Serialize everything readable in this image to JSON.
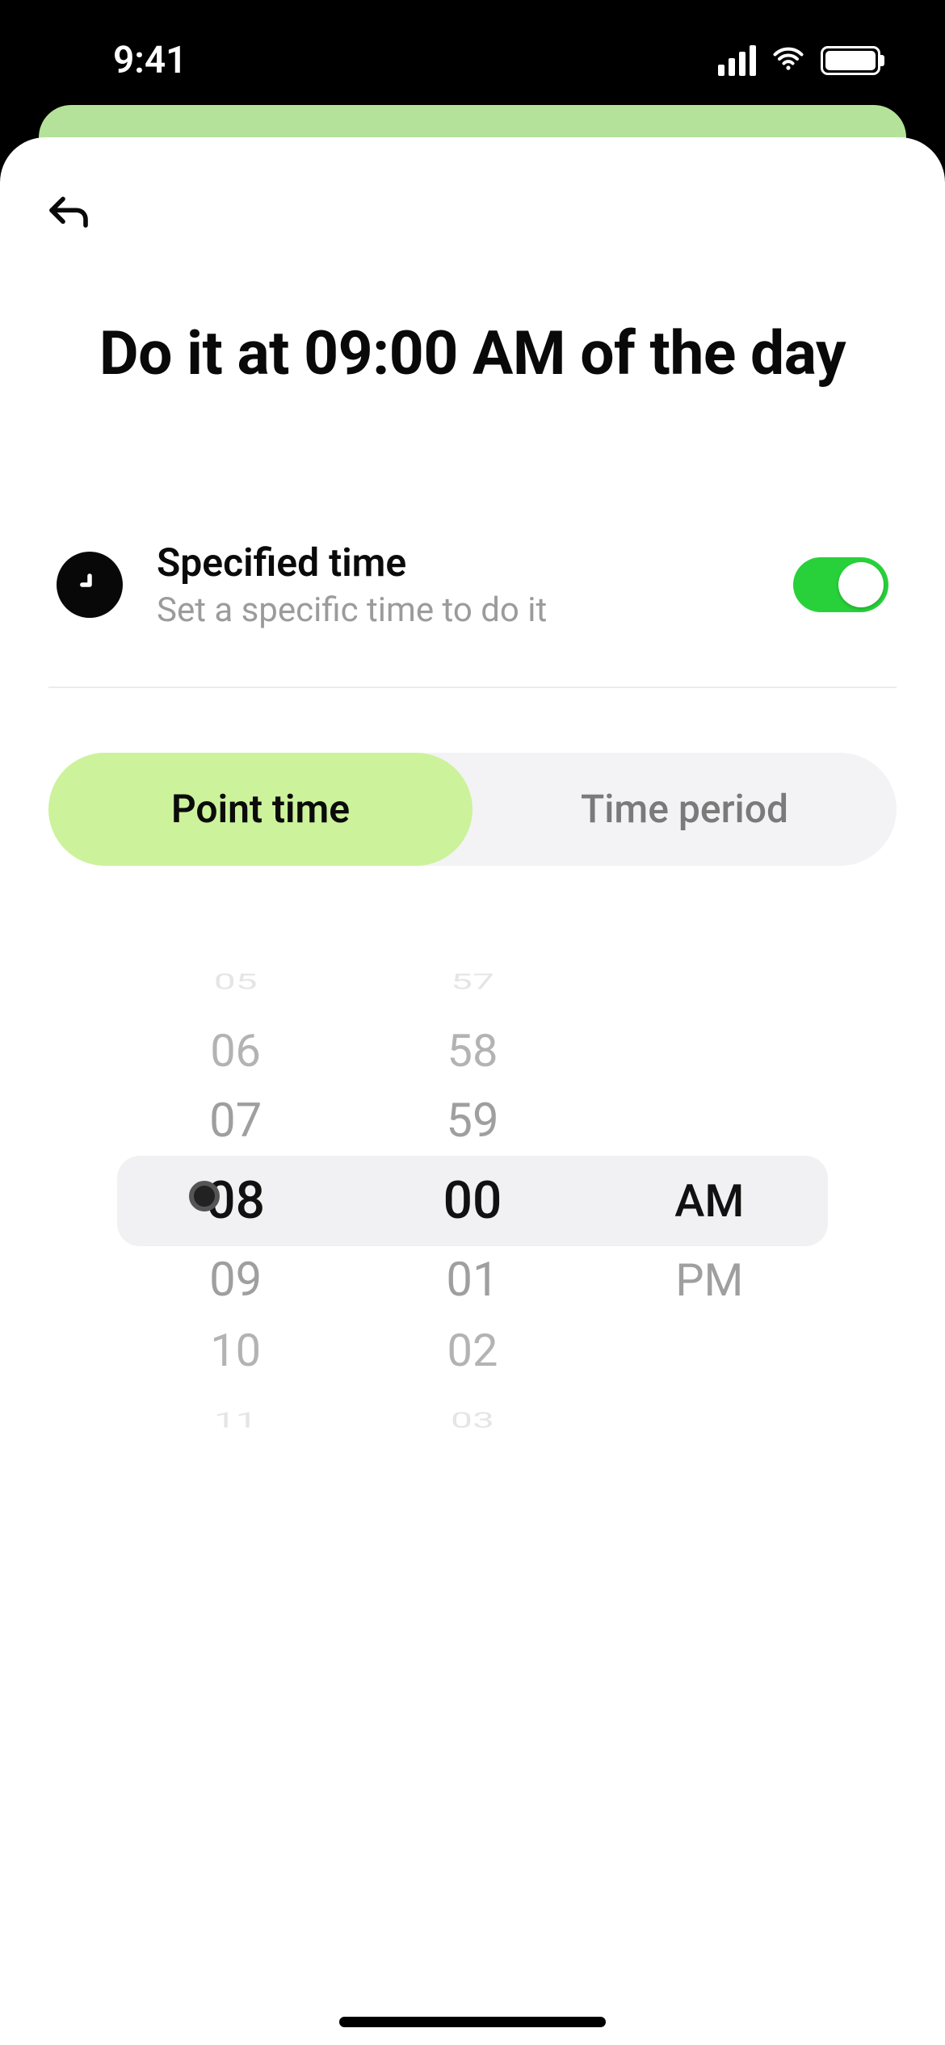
{
  "status": {
    "time": "9:41"
  },
  "header": {
    "title": "Do it at 09:00 AM of the day"
  },
  "specified": {
    "title": "Specified time",
    "subtitle": "Set a specific time to do it",
    "enabled": true
  },
  "segments": {
    "point": "Point time",
    "period": "Time period",
    "active": "point"
  },
  "picker": {
    "hours": [
      "05",
      "06",
      "07",
      "08",
      "09",
      "10",
      "11"
    ],
    "minutes": [
      "57",
      "58",
      "59",
      "00",
      "01",
      "02",
      "03"
    ],
    "ampm": [
      "",
      "",
      "",
      "AM",
      "PM",
      "",
      ""
    ],
    "selected": {
      "hour": "08",
      "minute": "00",
      "ampm": "AM"
    }
  }
}
